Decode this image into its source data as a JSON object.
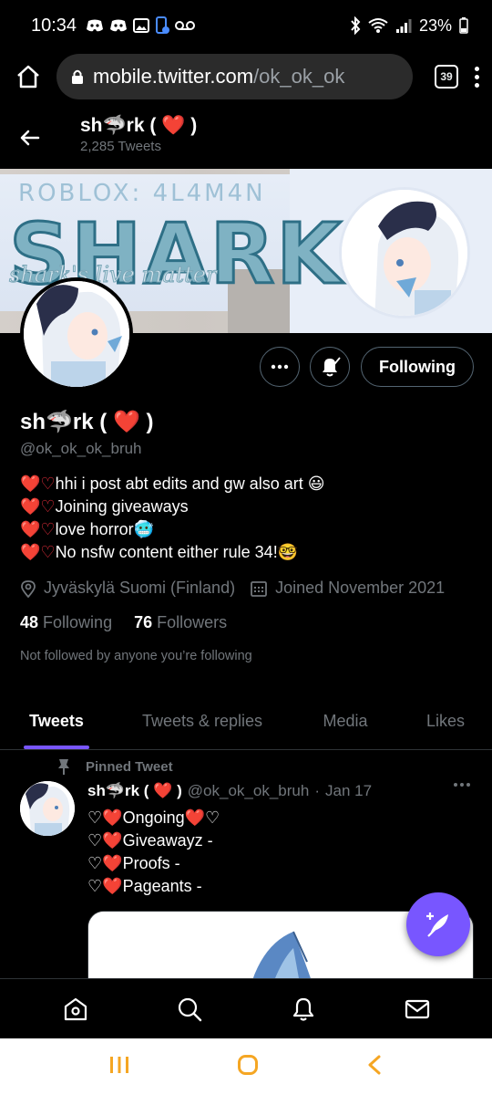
{
  "status_bar": {
    "time": "10:34",
    "battery": "23%",
    "icons": [
      "discord-icon",
      "discord-icon",
      "gallery-icon",
      "phone-icon",
      "voicemail-icon",
      "bluetooth-icon",
      "wifi-icon",
      "signal-icon",
      "battery-icon"
    ]
  },
  "browser": {
    "url_host": "mobile.twitter.com",
    "url_path": "/ok_ok_ok",
    "tab_count": "39"
  },
  "header": {
    "name_prefix": "sh",
    "name_suffix": "rk (",
    "name_close": ")",
    "tweet_count": "2,285 Tweets"
  },
  "banner": {
    "roblox_text": "ROBLOX: 4L4M4N",
    "title": "SHARK",
    "tagline": "shark's live matter"
  },
  "buttons": {
    "following": "Following"
  },
  "profile": {
    "name_prefix": "sh",
    "name_suffix": "rk (",
    "name_close": ")",
    "handle": "@ok_ok_ok_bruh",
    "bio": [
      {
        "text": "hhi i post abt edits and gw also art",
        "emoji": "😃"
      },
      {
        "text": "Joining giveaways",
        "emoji": ""
      },
      {
        "text": "love horror",
        "emoji": "🥶"
      },
      {
        "text": "No nsfw content either rule 34!",
        "emoji": "🤓"
      }
    ],
    "location": "Jyväskylä Suomi (Finland)",
    "joined": "Joined November 2021",
    "following_count": "48",
    "following_label": "Following",
    "followers_count": "76",
    "followers_label": "Followers",
    "not_followed": "Not followed by anyone you’re following"
  },
  "tabs": [
    "Tweets",
    "Tweets & replies",
    "Media",
    "Likes"
  ],
  "tweet": {
    "pinned_label": "Pinned Tweet",
    "name_prefix": "sh",
    "name_suffix": "rk (",
    "name_close": ")",
    "handle": "@ok_ok_ok_bruh",
    "dot": "·",
    "date": "Jan 17",
    "lines": [
      "Ongoing",
      "Giveawayz -",
      "Proofs -",
      "Pageants -"
    ]
  },
  "colors": {
    "accent": "#7856ff",
    "heart": "#f0303f",
    "muted": "#71767b"
  }
}
